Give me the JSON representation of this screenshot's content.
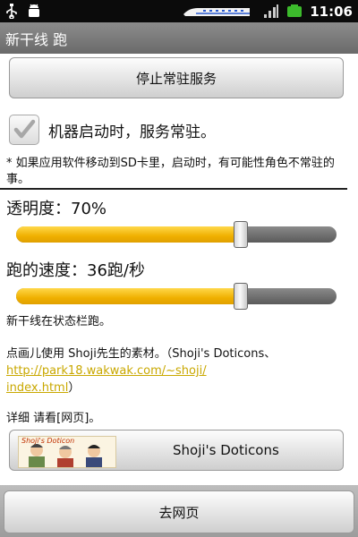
{
  "status_bar": {
    "time": "11:06"
  },
  "title": "新干线 跑",
  "stop_button_label": "停止常驻服务",
  "startup_checkbox": {
    "label": "机器启动时，服务常驻。",
    "checked": true
  },
  "note": "* 如果应用软件移动到SD卡里，启动时，有可能性角色不常驻的事。",
  "transparency": {
    "label": "透明度：70%",
    "value_percent": 70
  },
  "speed": {
    "label": "跑的速度：36跑/秒",
    "value_percent": 70
  },
  "statusbar_text": "新干线在状态栏跑。",
  "credit": {
    "prefix": "点画儿使用 Shoji先生的素材。（Shoji's Doticons、",
    "link_line1": "http://park18.wakwak.com/~shoji/",
    "link_line2": "index.html",
    "suffix": "）"
  },
  "details_text": "详细 请看[网页]。",
  "doticons_button": {
    "label": "Shoji's Doticons",
    "image_text": "Shoji's Doticon"
  },
  "goto_web_button_label": "去网页",
  "colors": {
    "accent": "#f0b000",
    "link": "#c9a800"
  }
}
